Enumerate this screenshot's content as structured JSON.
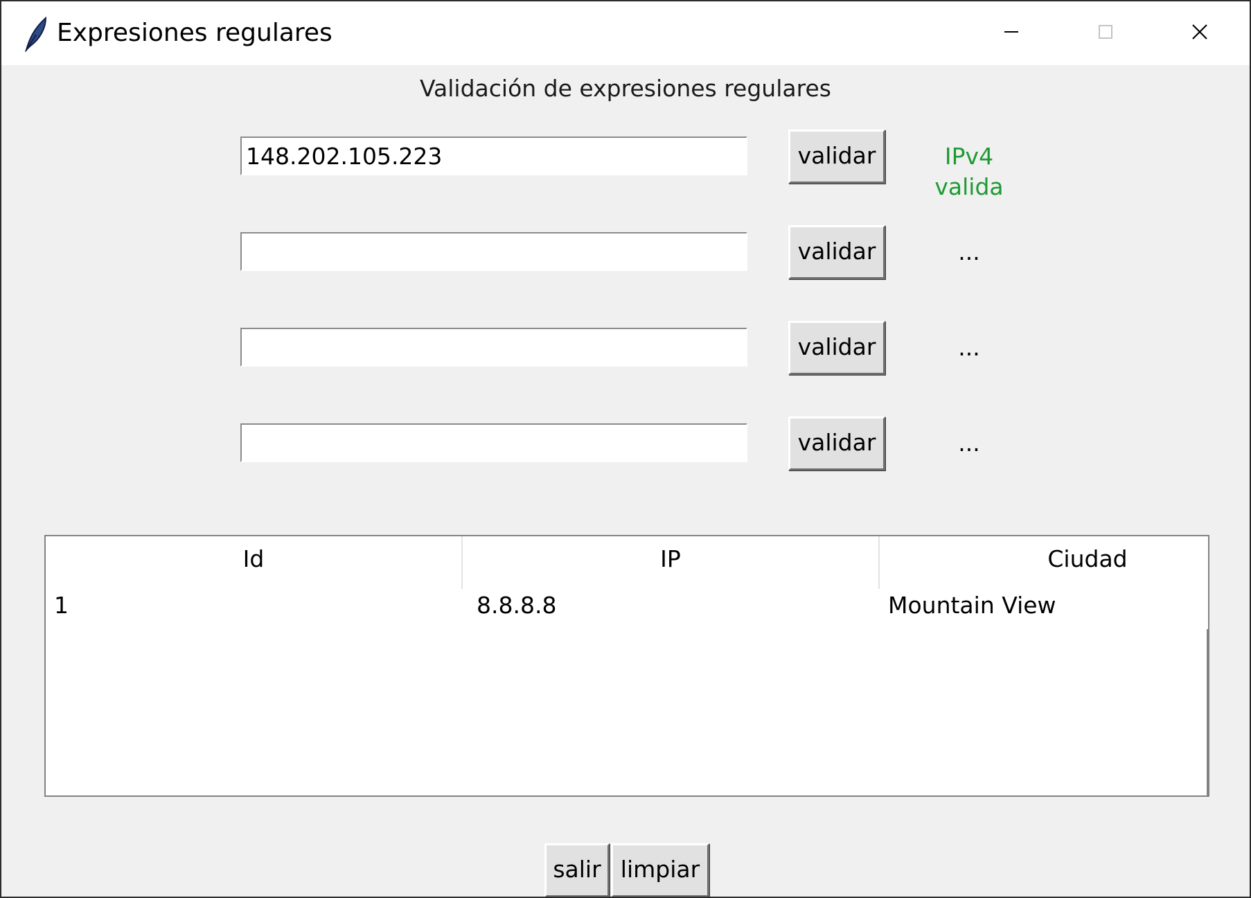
{
  "window": {
    "title": "Expresiones regulares",
    "icon": "feather-icon",
    "controls": [
      "minimize-icon",
      "maximize-icon",
      "close-icon"
    ]
  },
  "heading": "Validación de expresiones regulares",
  "rows": [
    {
      "value": "148.202.105.223",
      "button": "validar",
      "status": "IPv4 valida"
    },
    {
      "value": "",
      "button": "validar",
      "status": "..."
    },
    {
      "value": "",
      "button": "validar",
      "status": "..."
    },
    {
      "value": "",
      "button": "validar",
      "status": "..."
    }
  ],
  "table": {
    "columns": [
      "Id",
      "IP",
      "Ciudad"
    ],
    "rows": [
      [
        "1",
        "8.8.8.8",
        "Mountain View"
      ]
    ]
  },
  "buttons": {
    "exit": "salir",
    "clear": "limpiar"
  },
  "colors": {
    "valid": "#1e9a33",
    "window_bg": "#f0f0f0"
  }
}
